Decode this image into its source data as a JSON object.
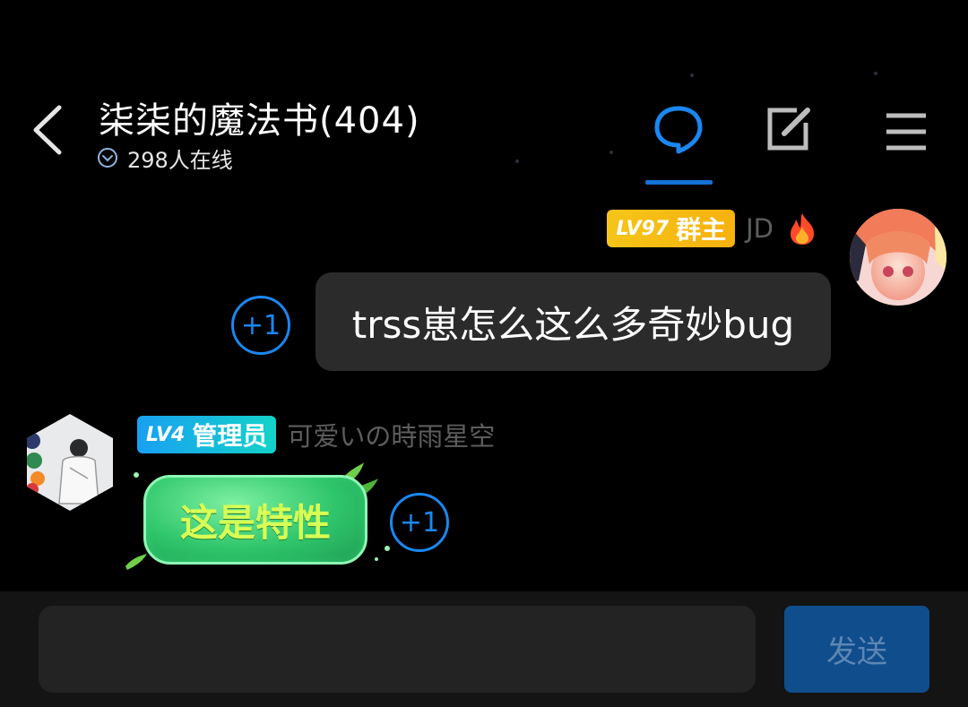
{
  "header": {
    "title": "柒柒的魔法书(404)",
    "online_count": "298人在线"
  },
  "messages": [
    {
      "badge_level": "LV97",
      "badge_role": "群主",
      "nickname": "JD",
      "text": "trss崽怎么这么多奇妙bug",
      "plus_one": "+1"
    },
    {
      "badge_level": "LV4",
      "badge_role": "管理员",
      "nickname": "可爱いの時雨星空",
      "text": "这是特性",
      "plus_one": "+1"
    }
  ],
  "composer": {
    "input_value": "",
    "send_label": "发送"
  },
  "colors": {
    "accent": "#1a87f0",
    "owner_badge": "#f5c518",
    "admin_badge": "#13c0d9",
    "bubble_dark": "#2b2b2b",
    "send_button": "#0f4d8c"
  },
  "icons": [
    "back-chevron-icon",
    "chevron-down-circle-icon",
    "chat-bubble-icon",
    "edit-icon",
    "menu-icon",
    "fire-icon"
  ]
}
